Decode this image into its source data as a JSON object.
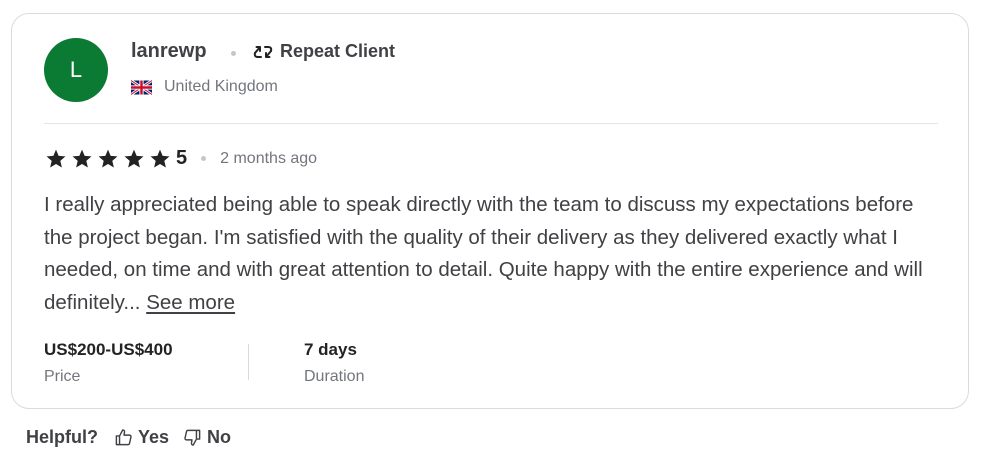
{
  "review": {
    "avatar_letter": "L",
    "username": "lanrewp",
    "repeat_client_label": "Repeat Client",
    "country": "United Kingdom",
    "rating": "5",
    "time_ago": "2 months ago",
    "text": "I really appreciated being able to speak directly with the team to discuss my expectations before the project began. I'm satisfied with the quality of their delivery as they delivered exactly what I needed, on time and with great attention to detail. Quite happy with the entire experience and will definitely...",
    "see_more_label": "See more",
    "price_value": "US$200-US$400",
    "price_label": "Price",
    "duration_value": "7 days",
    "duration_label": "Duration"
  },
  "helpful": {
    "label": "Helpful?",
    "yes_label": "Yes",
    "no_label": "No"
  },
  "icons": {
    "avatar_bg": "#0b7a32",
    "star_color": "#222325",
    "repeat": "repeat-icon",
    "flag": "uk-flag-icon",
    "thumbs_up": "thumbs-up-icon",
    "thumbs_down": "thumbs-down-icon"
  }
}
